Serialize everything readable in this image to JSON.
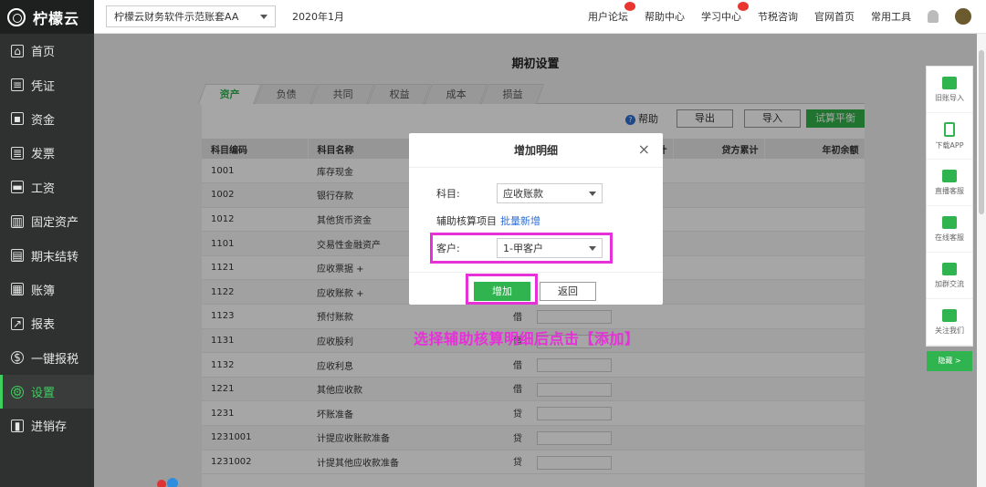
{
  "brand": {
    "name": "柠檬云"
  },
  "sidebar": {
    "items": [
      {
        "label": "首页",
        "icon": "home-icon",
        "glyph": "⌂"
      },
      {
        "label": "凭证",
        "icon": "voucher-icon",
        "glyph": "≡"
      },
      {
        "label": "资金",
        "icon": "fund-icon",
        "glyph": "▪"
      },
      {
        "label": "发票",
        "icon": "invoice-icon",
        "glyph": "≣"
      },
      {
        "label": "工资",
        "icon": "salary-icon",
        "glyph": "▬"
      },
      {
        "label": "固定资产",
        "icon": "asset-icon",
        "glyph": "▥"
      },
      {
        "label": "期末结转",
        "icon": "period-end-icon",
        "glyph": "▤"
      },
      {
        "label": "账簿",
        "icon": "ledger-icon",
        "glyph": "▦"
      },
      {
        "label": "报表",
        "icon": "report-icon",
        "glyph": "↗"
      },
      {
        "label": "一键报税",
        "icon": "tax-icon",
        "glyph": "$"
      },
      {
        "label": "设置",
        "icon": "settings-icon",
        "glyph": "⚙"
      },
      {
        "label": "进销存",
        "icon": "inventory-icon",
        "glyph": "▮"
      }
    ],
    "active_index": 10
  },
  "topbar": {
    "account": "柠檬云财务软件示范账套AA",
    "period": "2020年1月",
    "links": [
      "用户论坛",
      "帮助中心",
      "学习中心",
      "节税咨询",
      "官网首页",
      "常用工具"
    ],
    "hot_badges": [
      0,
      2
    ]
  },
  "page": {
    "title": "期初设置",
    "tabs": [
      "资产",
      "负债",
      "共同",
      "权益",
      "成本",
      "损益"
    ],
    "active_tab": 0,
    "toolbar": {
      "help": "帮助",
      "export": "导出",
      "import": "导入",
      "trial_balance": "试算平衡"
    }
  },
  "table": {
    "headers": [
      "科目编码",
      "科目名称",
      "",
      "借方累计",
      "贷方累计",
      "年初余额"
    ],
    "rows": [
      {
        "code": "1001",
        "name": "库存现金",
        "dir": ""
      },
      {
        "code": "1002",
        "name": "银行存款",
        "dir": ""
      },
      {
        "code": "1012",
        "name": "其他货币资金",
        "dir": ""
      },
      {
        "code": "1101",
        "name": "交易性金融资产",
        "dir": ""
      },
      {
        "code": "1121",
        "name": "应收票据  +",
        "dir": ""
      },
      {
        "code": "1122",
        "name": "应收账款  +",
        "dir": ""
      },
      {
        "code": "1123",
        "name": "预付账款",
        "dir": "借"
      },
      {
        "code": "1131",
        "name": "应收股利",
        "dir": "借"
      },
      {
        "code": "1132",
        "name": "应收利息",
        "dir": "借"
      },
      {
        "code": "1221",
        "name": "其他应收款",
        "dir": "借"
      },
      {
        "code": "1231",
        "name": "坏账准备",
        "dir": "贷"
      },
      {
        "code": "1231001",
        "name": "计提应收账款准备",
        "dir": "贷"
      },
      {
        "code": "1231002",
        "name": "计提其他应收款准备",
        "dir": "贷"
      }
    ]
  },
  "dialog": {
    "title": "增加明细",
    "close": "×",
    "subject_label": "科目:",
    "subject_value": "应收账款",
    "aux_label": "辅助核算项目",
    "batch_add": "批量新增",
    "customer_label": "客户:",
    "customer_value": "1-甲客户",
    "add_button": "增加",
    "back_button": "返回"
  },
  "annotation": "选择辅助核算明细后点击【添加】",
  "right_panel": {
    "items": [
      {
        "label": "旧账导入",
        "icon": "download-icon"
      },
      {
        "label": "下载APP",
        "icon": "phone-icon"
      },
      {
        "label": "直播客服",
        "icon": "video-icon"
      },
      {
        "label": "在线客服",
        "icon": "person-icon"
      },
      {
        "label": "加群交流",
        "icon": "group-icon"
      },
      {
        "label": "关注我们",
        "icon": "wechat-icon"
      }
    ],
    "hide": "隐藏 >"
  },
  "colors": {
    "accent": "#2fb44f",
    "highlight": "#e630d8",
    "sidebar": "#2f3030"
  }
}
